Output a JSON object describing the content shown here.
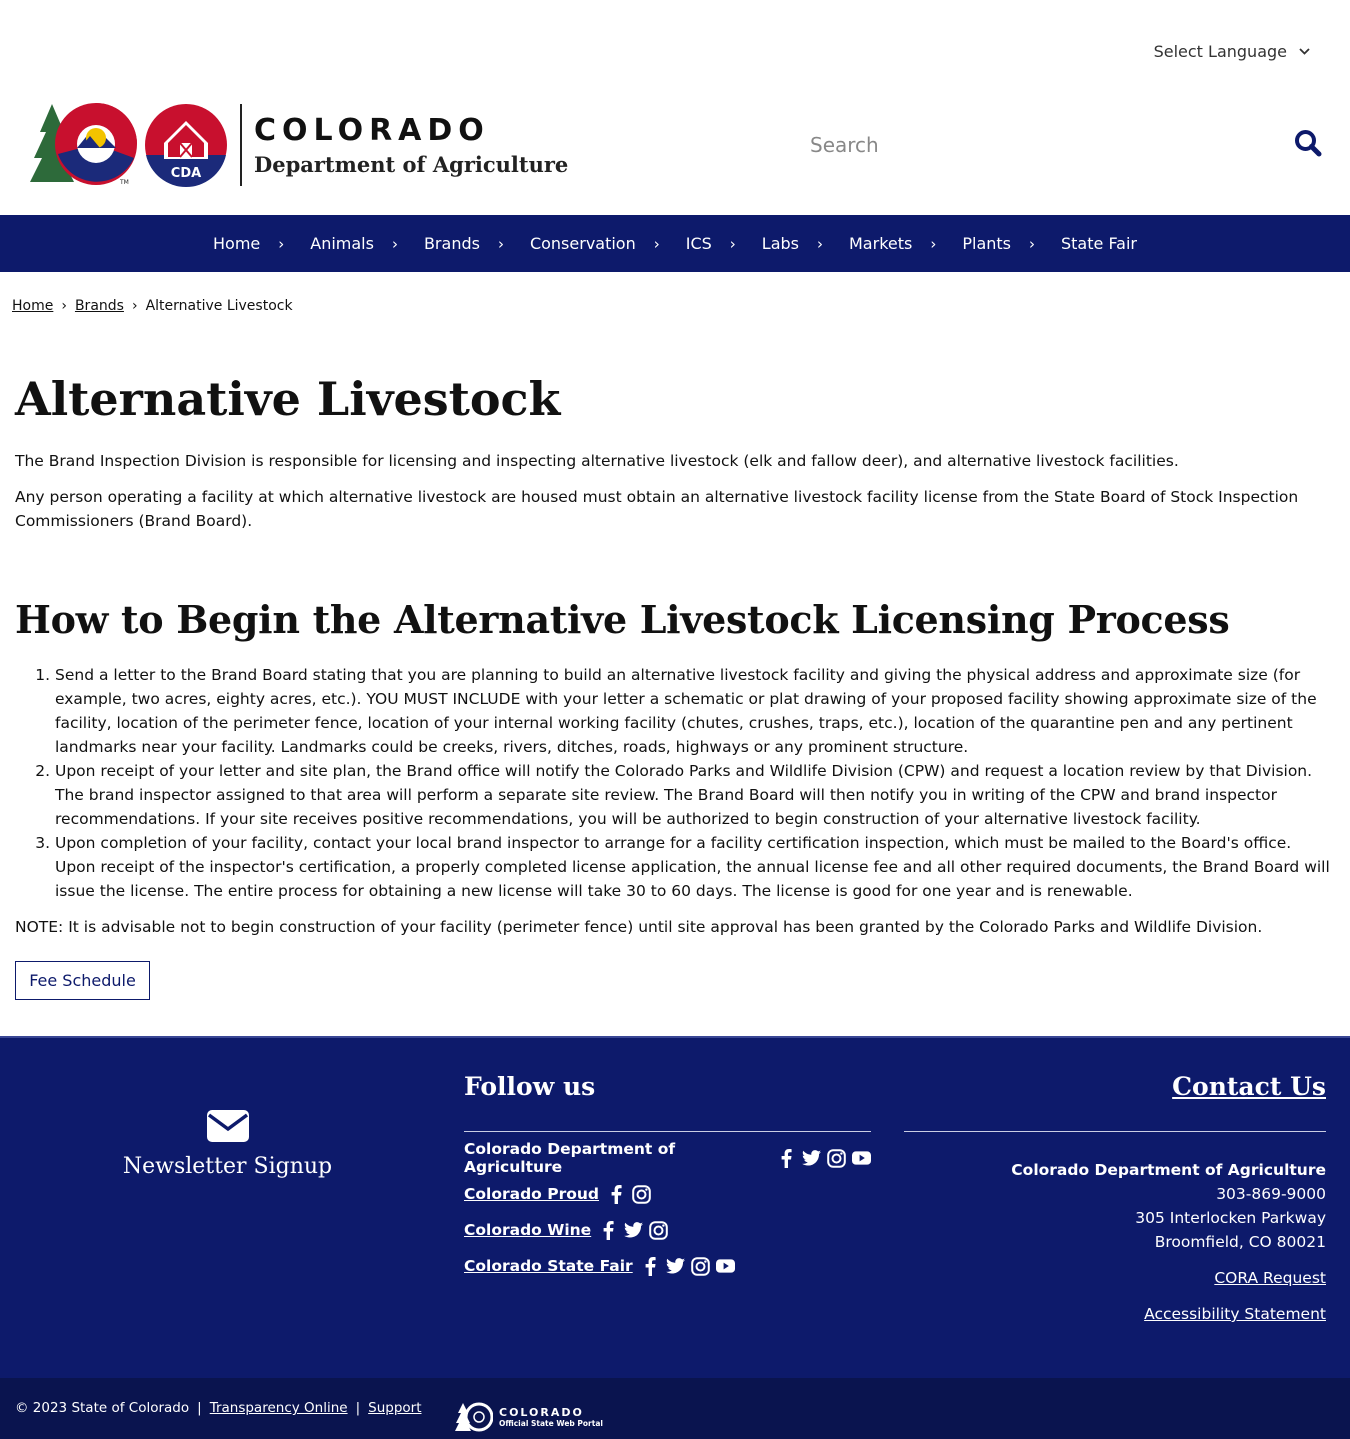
{
  "header": {
    "language_label": "Select Language",
    "logo": {
      "state": "COLORADO",
      "department": "Department of Agriculture",
      "badge": "CDA",
      "tm": "TM"
    },
    "search_placeholder": "Search"
  },
  "nav": {
    "items": [
      {
        "label": "Home"
      },
      {
        "label": "Animals"
      },
      {
        "label": "Brands"
      },
      {
        "label": "Conservation"
      },
      {
        "label": "ICS"
      },
      {
        "label": "Labs"
      },
      {
        "label": "Markets"
      },
      {
        "label": "Plants"
      },
      {
        "label": "State Fair"
      }
    ]
  },
  "breadcrumb": {
    "home": "Home",
    "brands": "Brands",
    "current": "Alternative Livestock"
  },
  "page": {
    "title": "Alternative Livestock",
    "intro1": "The Brand Inspection Division is responsible for licensing and inspecting alternative livestock (elk and fallow deer), and alternative livestock facilities.",
    "intro2": "Any person operating a facility at which alternative livestock are housed must obtain an alternative livestock facility license from the State Board of Stock Inspection Commissioners (Brand Board).",
    "section_title": "How to Begin the Alternative Livestock Licensing Process",
    "steps": [
      "Send a letter to the Brand Board stating that you are planning to build an alternative livestock facility and giving the physical address and approximate size (for example, two acres, eighty acres, etc.). YOU MUST INCLUDE with your letter a schematic or plat drawing of your proposed facility showing approximate size of the facility, location of the perimeter fence, location of your internal working facility (chutes, crushes, traps, etc.), location of the quarantine pen and any pertinent landmarks near your facility. Landmarks could be creeks, rivers, ditches, roads, highways or any prominent structure.",
      "Upon receipt of your letter and site plan, the Brand office will notify the Colorado Parks and Wildlife Division (CPW) and request a location review by that Division. The brand inspector assigned to that area will perform a separate site review. The Brand Board will then notify you in writing of the CPW and brand inspector recommendations. If your site receives positive recommendations, you will be authorized to begin construction of your alternative livestock facility.",
      "Upon completion of your facility, contact your local brand inspector to arrange for a facility certification inspection, which must be mailed to the Board's office. Upon receipt of the inspector's certification, a properly completed license application, the annual license fee and all other required documents, the Brand Board will issue the license. The entire process for obtaining a new license will take 30 to 60 days. The license is good for one year and is renewable."
    ],
    "note": "NOTE: It is advisable not to begin construction of your facility (perimeter fence) until site approval has been granted by the Colorado Parks and Wildlife Division.",
    "fee_button": "Fee Schedule"
  },
  "footer": {
    "newsletter": "Newsletter Signup",
    "follow_title": "Follow us",
    "social": [
      {
        "name": "Colorado Department of Agriculture",
        "icons": [
          "facebook-icon",
          "twitter-icon",
          "instagram-icon",
          "youtube-icon"
        ]
      },
      {
        "name": "Colorado Proud",
        "icons": [
          "facebook-icon",
          "instagram-icon"
        ]
      },
      {
        "name": "Colorado Wine",
        "icons": [
          "facebook-icon",
          "twitter-icon",
          "instagram-icon"
        ]
      },
      {
        "name": "Colorado State Fair",
        "icons": [
          "facebook-icon",
          "twitter-icon",
          "instagram-icon",
          "youtube-icon"
        ]
      }
    ],
    "contact_title": "Contact Us",
    "contact": {
      "org": "Colorado Department of Agriculture",
      "phone": "303-869-9000",
      "street": "305 Interlocken Parkway",
      "city": "Broomfield, CO 80021"
    },
    "cora": "CORA Request",
    "accessibility": "Accessibility Statement",
    "copyright": "© 2023 State of Colorado",
    "sep": "|",
    "transparency": "Transparency Online",
    "support": "Support",
    "portal_title": "COLORADO",
    "portal_sub": "Official State Web Portal"
  },
  "colors": {
    "navy": "#0d1a6b",
    "footer_bottom": "#0a144f",
    "logo_red": "#c8102e",
    "logo_blue": "#1b2a7a",
    "logo_gold": "#f2c300",
    "logo_green": "#2d6a3a"
  }
}
